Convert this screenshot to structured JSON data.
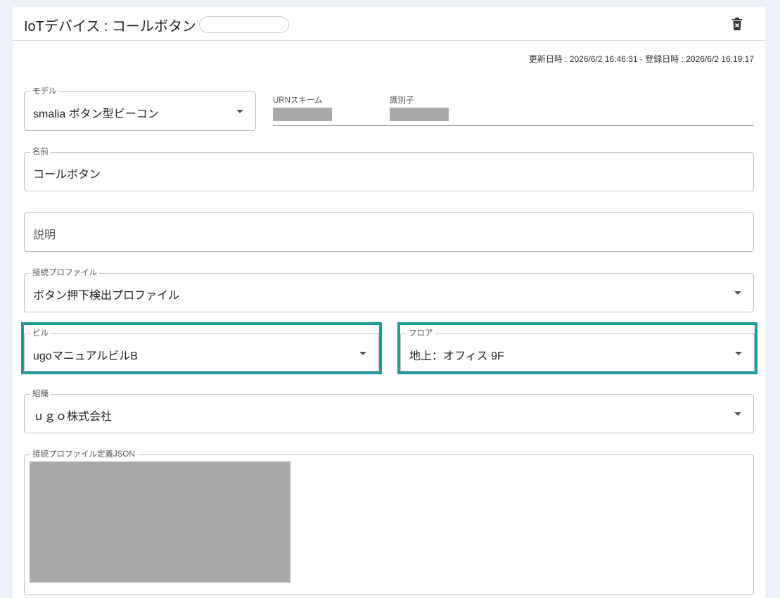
{
  "header": {
    "title": "IoTデバイス : コールボタン",
    "delete_icon": "trash-icon"
  },
  "timestamps": {
    "text": "更新日時 : 2026/6/2 16:46:31 - 登録日時 : 2026/6/2 16:19:17"
  },
  "form": {
    "model": {
      "label": "モデル",
      "value": "smalia ボタン型ビーコン"
    },
    "urn": {
      "label": "URNスキーム"
    },
    "identifier": {
      "label": "識別子"
    },
    "name": {
      "label": "名前",
      "value": "コールボタン"
    },
    "description": {
      "placeholder": "説明"
    },
    "connection_profile": {
      "label": "接続プロファイル",
      "value": "ボタン押下検出プロファイル"
    },
    "building": {
      "label": "ビル",
      "value": "ugoマニュアルビルB"
    },
    "floor": {
      "label": "フロア",
      "value": "地上：オフィス 9F"
    },
    "organization": {
      "label": "組織",
      "value": "ｕｇｏ株式会社"
    },
    "profile_json": {
      "label": "接続プロファイル定義JSON"
    }
  },
  "colors": {
    "highlight": "#1e9a98",
    "redaction": "#a9a9a9"
  }
}
